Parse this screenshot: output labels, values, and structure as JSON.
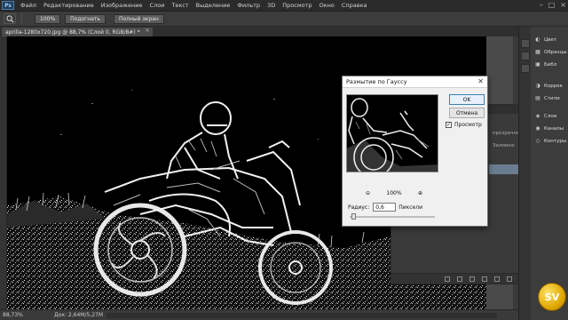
{
  "menubar": {
    "app_logo": "Ps",
    "items": [
      "Файл",
      "Редактирование",
      "Изображение",
      "Слои",
      "Текст",
      "Выделение",
      "Фильтр",
      "3D",
      "Просмотр",
      "Окно",
      "Справка"
    ]
  },
  "options_bar": {
    "zoom_value": "100%",
    "fit_label": "Подогнать",
    "fill_screen_label": "Полный экран"
  },
  "document_tab": {
    "title": "aprilia-1280x720.jpg @ 88,7% (Слой 0, RGB/8#) *",
    "close": "×"
  },
  "status_bar": {
    "zoom": "88,73%",
    "doc_info": "Док: 2,64М/5,27М",
    "arrow": "▶"
  },
  "right_panels": {
    "items": [
      {
        "icon": "color-icon",
        "label": "Цвет"
      },
      {
        "icon": "swatches-icon",
        "label": "Образцы"
      },
      {
        "icon": "libraries-icon",
        "label": "Библ"
      },
      {
        "icon": "adjustments-icon",
        "label": "Коррек"
      },
      {
        "icon": "styles-icon",
        "label": "Стили"
      },
      {
        "icon": "layers-icon",
        "label": "Слои"
      },
      {
        "icon": "channels-icon",
        "label": "Каналы"
      },
      {
        "icon": "paths-icon",
        "label": "Контуры"
      }
    ]
  },
  "layers_panel": {
    "row_opacity": "прозрачность:",
    "row_fill": "Заливка:"
  },
  "dialog": {
    "title": "Размытие по Гауссу",
    "close": "✕",
    "ok_label": "OK",
    "cancel_label": "Отмена",
    "preview_label": "Просмотр",
    "preview_checked": "✓",
    "zoom_out": "⊖",
    "zoom_value": "100%",
    "zoom_in": "⊕",
    "radius_label": "Радиус:",
    "radius_value": "0,6",
    "radius_unit": "Пиксели",
    "radius_slider_fraction": 0.02
  },
  "watermark": {
    "text": "SV"
  },
  "colors": {
    "app_bg": "#3b3b3b",
    "menubar_bg": "#2b2b2b",
    "dialog_bg": "#f0f0f0",
    "selected_layer": "#6a7c8f"
  }
}
